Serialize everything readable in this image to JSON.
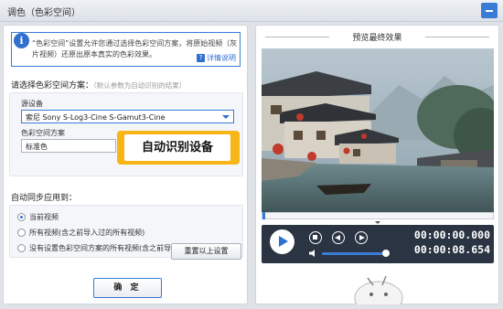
{
  "window": {
    "title": "调色（色彩空间）"
  },
  "info": {
    "icon": "info-icon",
    "text": "“色彩空间”设置允许您通过选择色彩空间方案，将原始视频（灰片视频）还原出原本真实的色彩效果。",
    "detail_label": "详情说明"
  },
  "section_colorspace": {
    "title": "请选择色彩空间方案：",
    "hint": "（默认参数为自动识别的结果）"
  },
  "source_device": {
    "label": "源设备",
    "value": "索尼 Sony S-Log3-Cine S-Gamut3-Cine"
  },
  "colorspace_scheme": {
    "label": "色彩空间方案",
    "value": "标准色"
  },
  "callout": {
    "text": "自动识别设备"
  },
  "sync": {
    "title": "自动同步应用到：",
    "options": [
      {
        "label": "当前视频",
        "selected": true
      },
      {
        "label": "所有视频(含之前导入过的所有视频)",
        "selected": false
      },
      {
        "label": "没有设置色彩空间方案的所有视频(含之前导入过的所有视频)",
        "selected": false
      }
    ]
  },
  "buttons": {
    "reset": "重置以上设置",
    "ok": "确 定"
  },
  "preview": {
    "title": "预览最终效果",
    "time_current": "00:00:00.000",
    "time_total": "00:00:08.654",
    "volume_level": 0.95
  },
  "colors": {
    "accent": "#3a7bd5",
    "callout": "#f7b516",
    "controls_bg": "#2a3442"
  }
}
